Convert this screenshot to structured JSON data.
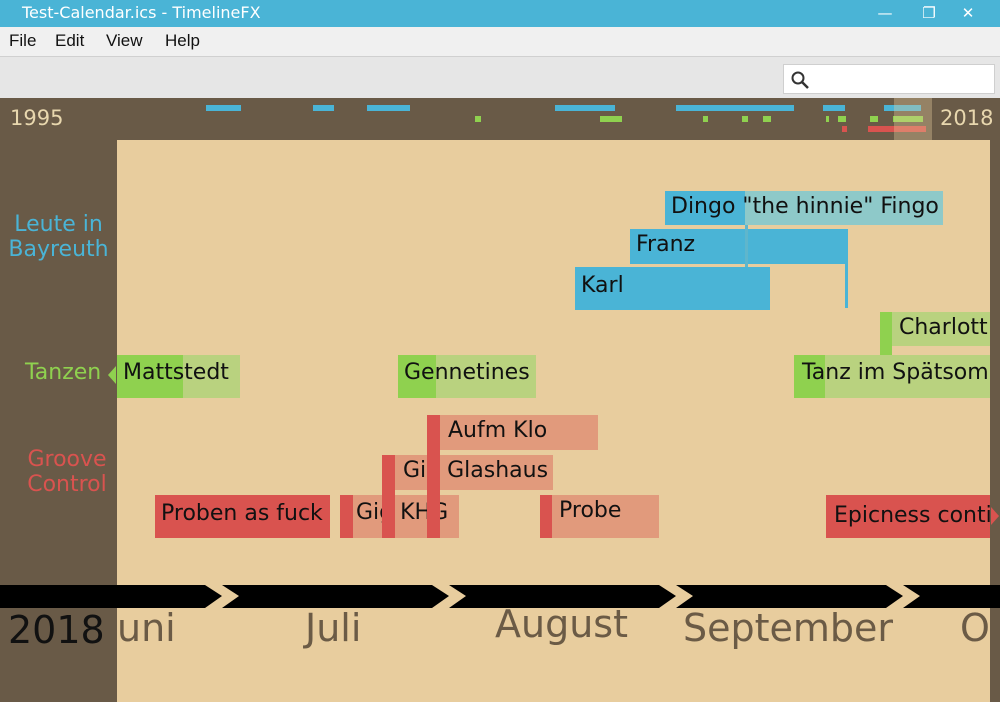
{
  "window": {
    "title": "Test-Calendar.ics - TimelineFX",
    "minimize": "—",
    "maximize": "❐",
    "close": "✕"
  },
  "menu": {
    "items": [
      "File",
      "Edit",
      "View",
      "Help"
    ]
  },
  "search": {
    "value": "",
    "placeholder": ""
  },
  "overview": {
    "start_year": "1995",
    "end_year": "2018"
  },
  "categories": [
    {
      "label": "Leute in\nBayreuth",
      "color": "#4ab4d6"
    },
    {
      "label": "Tanzen",
      "color": "#8fd14f"
    },
    {
      "label": "Groove\nControl",
      "color": "#d9534f"
    }
  ],
  "events": {
    "dingo": "Dingo \"the hinnie\" Fingo",
    "franz": "Franz",
    "karl": "Karl",
    "charlott": "Charlott",
    "mattstedt": "Mattstedt",
    "gennetines": "Gennetines",
    "tanz": "Tanz im Spätsom",
    "aufm_klo": "Aufm Klo",
    "gig_glashaus": "Gig Glashaus",
    "gig_khg": "Gig KHG",
    "probe": "Probe",
    "proben": "Proben as fuck",
    "epicness": "Epicness conti"
  },
  "axis": {
    "year": "2018",
    "months": [
      "uni",
      "Juli",
      "August",
      "September",
      "O"
    ]
  },
  "colors": {
    "blue": "#4ab4d6",
    "blue_light": "#8ec9c9",
    "green": "#8fd14f",
    "green_light": "#b9d27f",
    "red": "#d9534f",
    "red_light": "#e19a7c"
  }
}
